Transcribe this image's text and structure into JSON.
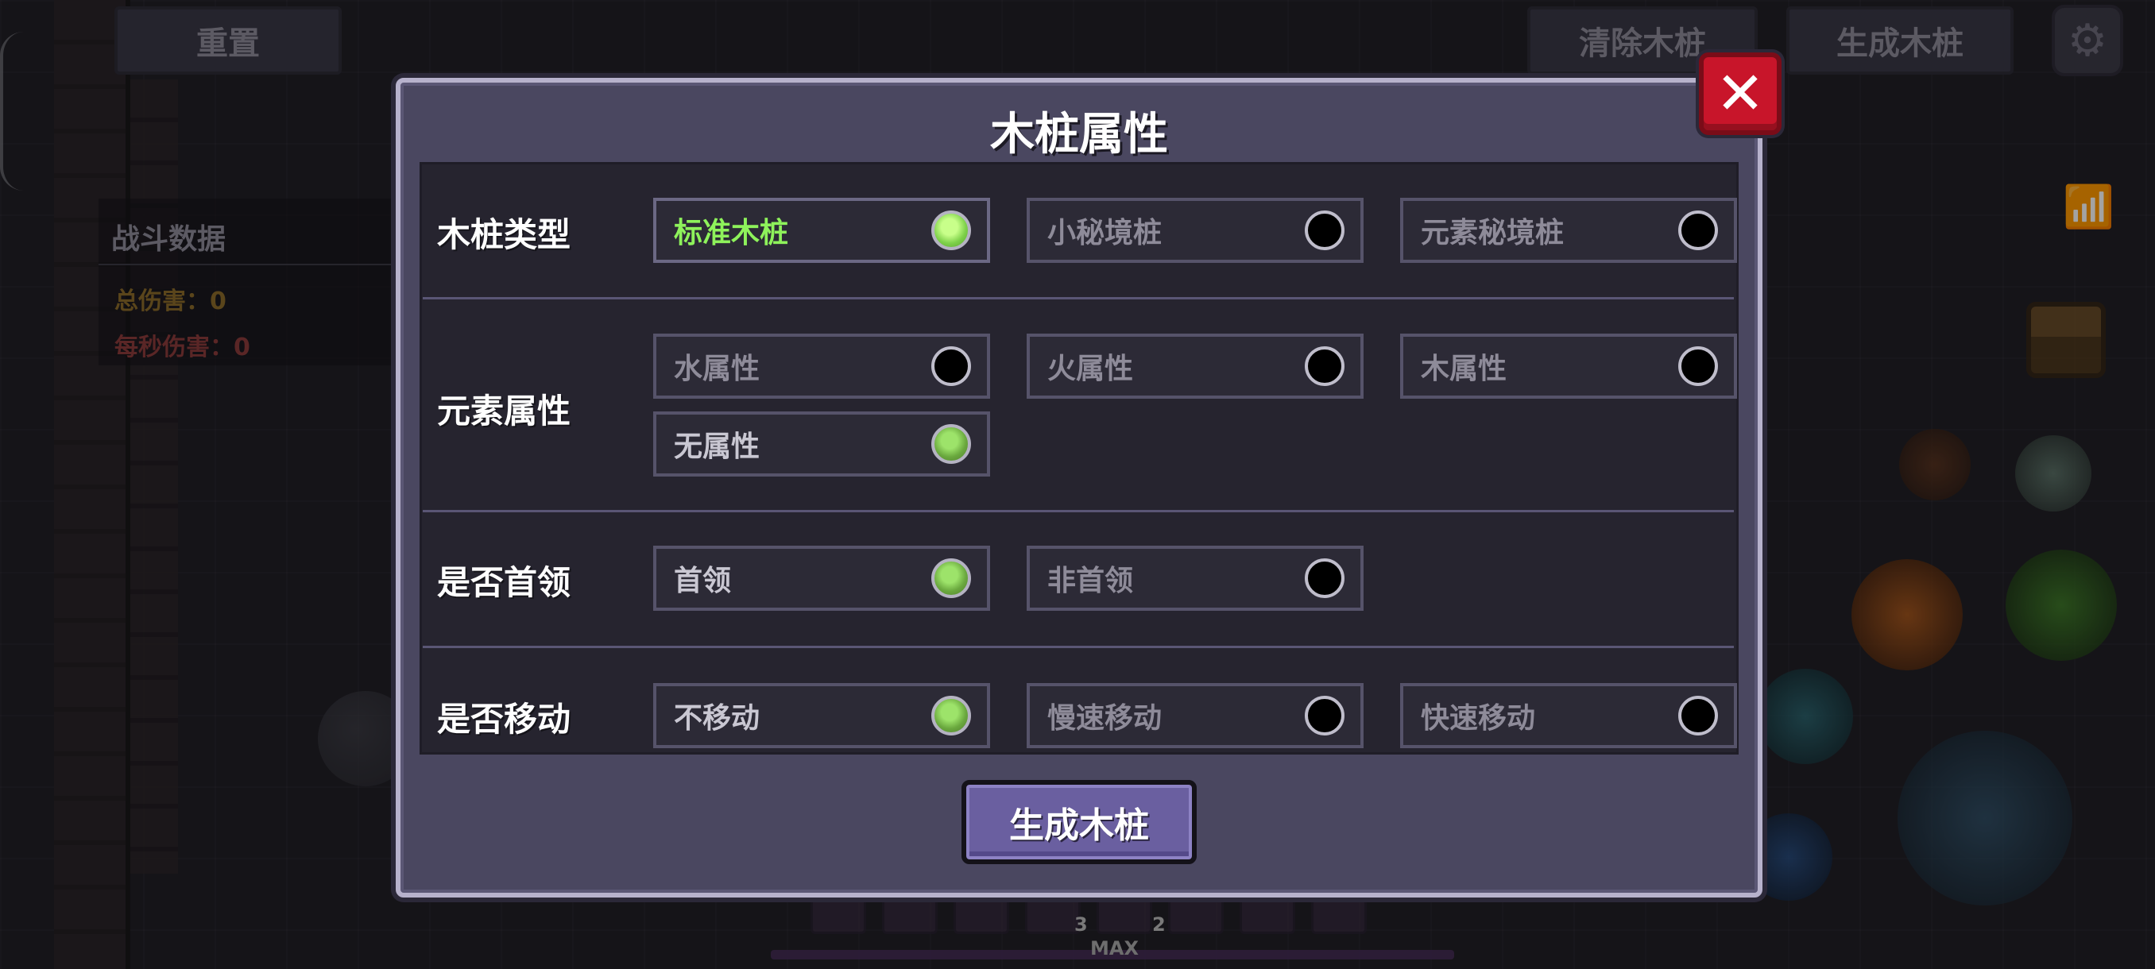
{
  "top_bar": {
    "reset_label": "重置",
    "clear_label": "清除木桩",
    "generate_label": "生成木桩"
  },
  "battle_stats": {
    "title": "战斗数据",
    "total_damage": "总伤害：0",
    "dps": "每秒伤害：0"
  },
  "hud": {
    "max_label": "MAX",
    "hotbar_counts": [
      "3",
      "2"
    ]
  },
  "dialog": {
    "title": "木桩属性",
    "close_label": "✕",
    "rows": [
      {
        "label": "木桩类型",
        "options": [
          {
            "label": "标准木桩",
            "selected": true
          },
          {
            "label": "小秘境桩",
            "selected": false
          },
          {
            "label": "元素秘境桩",
            "selected": false
          }
        ]
      },
      {
        "label": "元素属性",
        "options": [
          {
            "label": "水属性",
            "selected": false
          },
          {
            "label": "火属性",
            "selected": false
          },
          {
            "label": "木属性",
            "selected": false
          },
          {
            "label": "无属性",
            "selected": true
          }
        ]
      },
      {
        "label": "是否首领",
        "options": [
          {
            "label": "首领",
            "selected": true
          },
          {
            "label": "非首领",
            "selected": false
          }
        ]
      },
      {
        "label": "是否移动",
        "options": [
          {
            "label": "不移动",
            "selected": true
          },
          {
            "label": "慢速移动",
            "selected": false
          },
          {
            "label": "快速移动",
            "selected": false
          }
        ]
      }
    ],
    "generate_button": "生成木桩"
  },
  "colors": {
    "active_green": "#8ef25b",
    "close_red": "#c8152a",
    "button_purple": "#6a5fa0"
  }
}
